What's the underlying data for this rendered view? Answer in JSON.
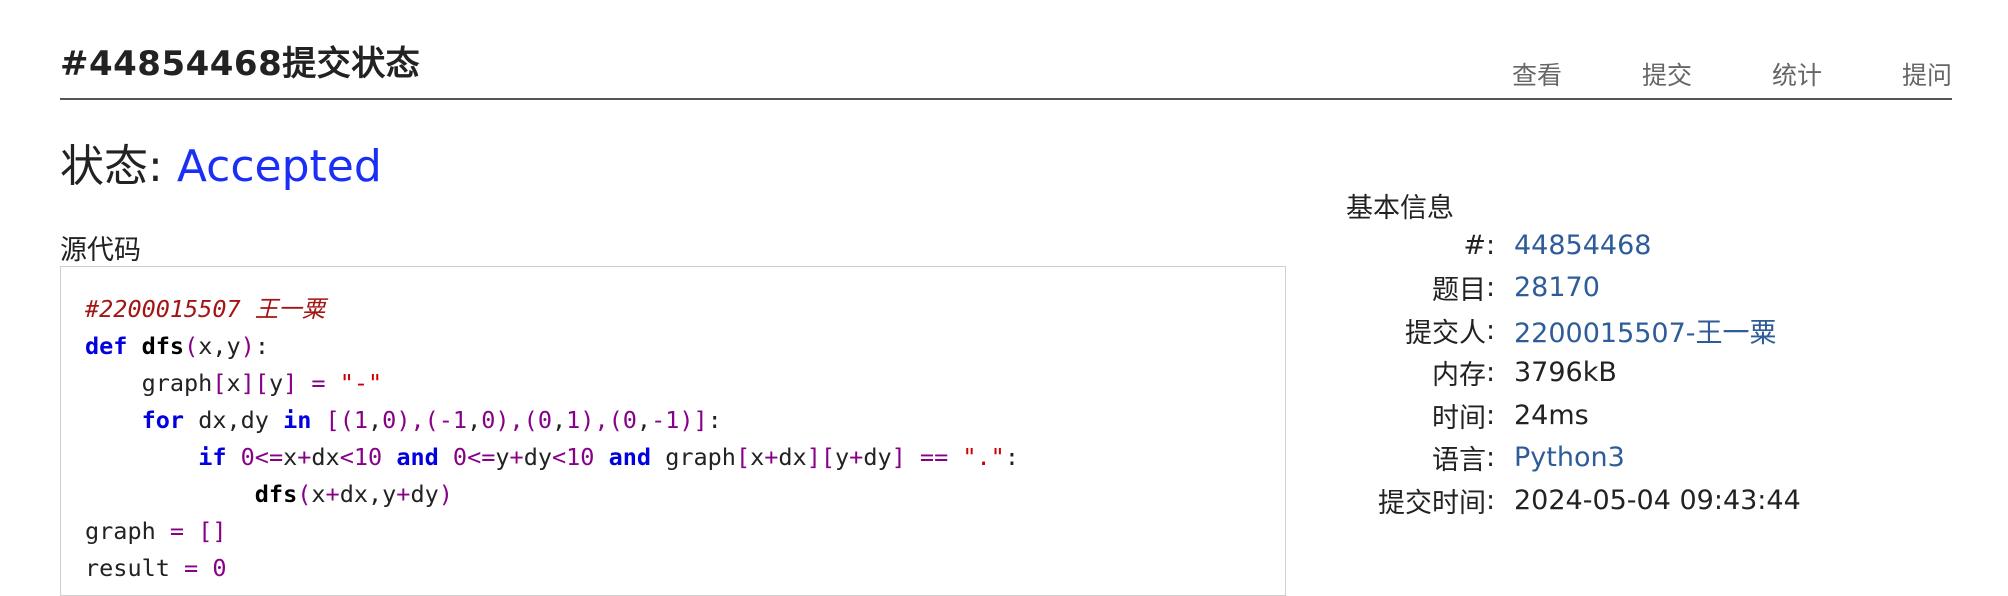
{
  "header": {
    "title": "#44854468提交状态",
    "nav": [
      "查看",
      "提交",
      "统计",
      "提问"
    ]
  },
  "status": {
    "label": "状态: ",
    "value": "Accepted"
  },
  "code": {
    "label": "源代码",
    "lines": [
      [
        [
          "com",
          "#2200015507 王一粟"
        ]
      ],
      [
        [
          "kw",
          "def"
        ],
        [
          "txt",
          " "
        ],
        [
          "fn",
          "dfs"
        ],
        [
          "punc",
          "("
        ],
        [
          "txt",
          "x,y"
        ],
        [
          "punc",
          ")"
        ],
        [
          "txt",
          ":"
        ]
      ],
      [
        [
          "txt",
          "    graph"
        ],
        [
          "punc",
          "["
        ],
        [
          "txt",
          "x"
        ],
        [
          "punc",
          "]["
        ],
        [
          "txt",
          "y"
        ],
        [
          "punc",
          "]"
        ],
        [
          "txt",
          " "
        ],
        [
          "op",
          "="
        ],
        [
          "txt",
          " "
        ],
        [
          "str",
          "\"-\""
        ]
      ],
      [
        [
          "txt",
          "    "
        ],
        [
          "kw",
          "for"
        ],
        [
          "txt",
          " dx,dy "
        ],
        [
          "kw",
          "in"
        ],
        [
          "txt",
          " "
        ],
        [
          "punc",
          "[("
        ],
        [
          "num",
          "1"
        ],
        [
          "txt",
          ","
        ],
        [
          "num",
          "0"
        ],
        [
          "punc",
          "),("
        ],
        [
          "num",
          "-1"
        ],
        [
          "txt",
          ","
        ],
        [
          "num",
          "0"
        ],
        [
          "punc",
          "),("
        ],
        [
          "num",
          "0"
        ],
        [
          "txt",
          ","
        ],
        [
          "num",
          "1"
        ],
        [
          "punc",
          "),("
        ],
        [
          "num",
          "0"
        ],
        [
          "txt",
          ","
        ],
        [
          "num",
          "-1"
        ],
        [
          "punc",
          ")]"
        ],
        [
          "txt",
          ":"
        ]
      ],
      [
        [
          "txt",
          "        "
        ],
        [
          "kw",
          "if"
        ],
        [
          "txt",
          " "
        ],
        [
          "num",
          "0"
        ],
        [
          "op",
          "<="
        ],
        [
          "txt",
          "x"
        ],
        [
          "op",
          "+"
        ],
        [
          "txt",
          "dx"
        ],
        [
          "op",
          "<"
        ],
        [
          "num",
          "10"
        ],
        [
          "txt",
          " "
        ],
        [
          "kw",
          "and"
        ],
        [
          "txt",
          " "
        ],
        [
          "num",
          "0"
        ],
        [
          "op",
          "<="
        ],
        [
          "txt",
          "y"
        ],
        [
          "op",
          "+"
        ],
        [
          "txt",
          "dy"
        ],
        [
          "op",
          "<"
        ],
        [
          "num",
          "10"
        ],
        [
          "txt",
          " "
        ],
        [
          "kw",
          "and"
        ],
        [
          "txt",
          " graph"
        ],
        [
          "punc",
          "["
        ],
        [
          "txt",
          "x"
        ],
        [
          "op",
          "+"
        ],
        [
          "txt",
          "dx"
        ],
        [
          "punc",
          "]["
        ],
        [
          "txt",
          "y"
        ],
        [
          "op",
          "+"
        ],
        [
          "txt",
          "dy"
        ],
        [
          "punc",
          "]"
        ],
        [
          "txt",
          " "
        ],
        [
          "op",
          "=="
        ],
        [
          "txt",
          " "
        ],
        [
          "str",
          "\".\""
        ],
        [
          "txt",
          ":"
        ]
      ],
      [
        [
          "txt",
          "            "
        ],
        [
          "fn",
          "dfs"
        ],
        [
          "punc",
          "("
        ],
        [
          "txt",
          "x"
        ],
        [
          "op",
          "+"
        ],
        [
          "txt",
          "dx,y"
        ],
        [
          "op",
          "+"
        ],
        [
          "txt",
          "dy"
        ],
        [
          "punc",
          ")"
        ]
      ],
      [
        [
          "txt",
          "graph "
        ],
        [
          "op",
          "="
        ],
        [
          "txt",
          " "
        ],
        [
          "punc",
          "[]"
        ]
      ],
      [
        [
          "txt",
          "result "
        ],
        [
          "op",
          "="
        ],
        [
          "txt",
          " "
        ],
        [
          "num",
          "0"
        ]
      ]
    ]
  },
  "info": {
    "title": "基本信息",
    "rows": [
      {
        "key": "#",
        "value": "44854468",
        "link": true
      },
      {
        "key": "题目",
        "value": "28170",
        "link": true
      },
      {
        "key": "提交人",
        "value": "2200015507-王一粟",
        "link": true
      },
      {
        "key": "内存",
        "value": "3796kB",
        "link": false
      },
      {
        "key": "时间",
        "value": "24ms",
        "link": false
      },
      {
        "key": "语言",
        "value": "Python3",
        "link": true
      },
      {
        "key": "提交时间",
        "value": "2024-05-04 09:43:44",
        "link": false
      }
    ]
  }
}
